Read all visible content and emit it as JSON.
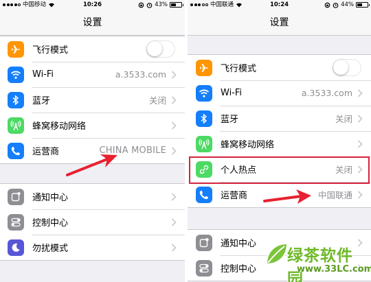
{
  "left_screen": {
    "status": {
      "carrier": "中国移动",
      "time": "10:26",
      "battery": "43%",
      "battery_level": 0.43
    },
    "title": "设置",
    "group1": [
      {
        "label": "飞行模式",
        "icon": "airplane-icon",
        "color": "#ff9500",
        "control": "toggle",
        "value": ""
      },
      {
        "label": "Wi-Fi",
        "icon": "wifi-icon",
        "color": "#147efb",
        "control": "chevron",
        "value": "a.3533.com"
      },
      {
        "label": "蓝牙",
        "icon": "bluetooth-icon",
        "color": "#147efb",
        "control": "chevron",
        "value": "关闭"
      },
      {
        "label": "蜂窝移动网络",
        "icon": "cellular-icon",
        "color": "#4cd964",
        "control": "chevron",
        "value": ""
      },
      {
        "label": "运营商",
        "icon": "phone-icon",
        "color": "#147efb",
        "control": "chevron",
        "value": "CHINA MOBILE"
      }
    ],
    "group2": [
      {
        "label": "通知中心",
        "icon": "notification-icon",
        "color": "#8e8e93"
      },
      {
        "label": "控制中心",
        "icon": "control-center-icon",
        "color": "#8e8e93"
      },
      {
        "label": "勿扰模式",
        "icon": "moon-icon",
        "color": "#5856d6"
      }
    ]
  },
  "right_screen": {
    "status": {
      "carrier": "中国联通",
      "time": "10:24",
      "battery": "44%",
      "battery_level": 0.44
    },
    "title": "设置",
    "group1": [
      {
        "label": "飞行模式",
        "icon": "airplane-icon",
        "color": "#ff9500",
        "control": "toggle",
        "value": ""
      },
      {
        "label": "Wi-Fi",
        "icon": "wifi-icon",
        "color": "#147efb",
        "control": "chevron",
        "value": "a.3533.com"
      },
      {
        "label": "蓝牙",
        "icon": "bluetooth-icon",
        "color": "#147efb",
        "control": "chevron",
        "value": "关闭"
      },
      {
        "label": "蜂窝移动网络",
        "icon": "cellular-icon",
        "color": "#4cd964",
        "control": "chevron",
        "value": ""
      },
      {
        "label": "个人热点",
        "icon": "hotspot-icon",
        "color": "#4cd964",
        "control": "chevron",
        "value": "关闭"
      },
      {
        "label": "运营商",
        "icon": "phone-icon",
        "color": "#147efb",
        "control": "chevron",
        "value": "中国联通"
      }
    ],
    "group2": [
      {
        "label": "通知中心",
        "icon": "notification-icon",
        "color": "#8e8e93"
      },
      {
        "label": "控制中心",
        "icon": "control-center-icon",
        "color": "#8e8e93"
      }
    ]
  },
  "annotations": {
    "arrow_color": "#e8202f",
    "highlight_color": "#d4233d"
  },
  "watermark": {
    "title": "绿茶软件园",
    "url": "www.33LC.com",
    "color": "#6fb829"
  }
}
